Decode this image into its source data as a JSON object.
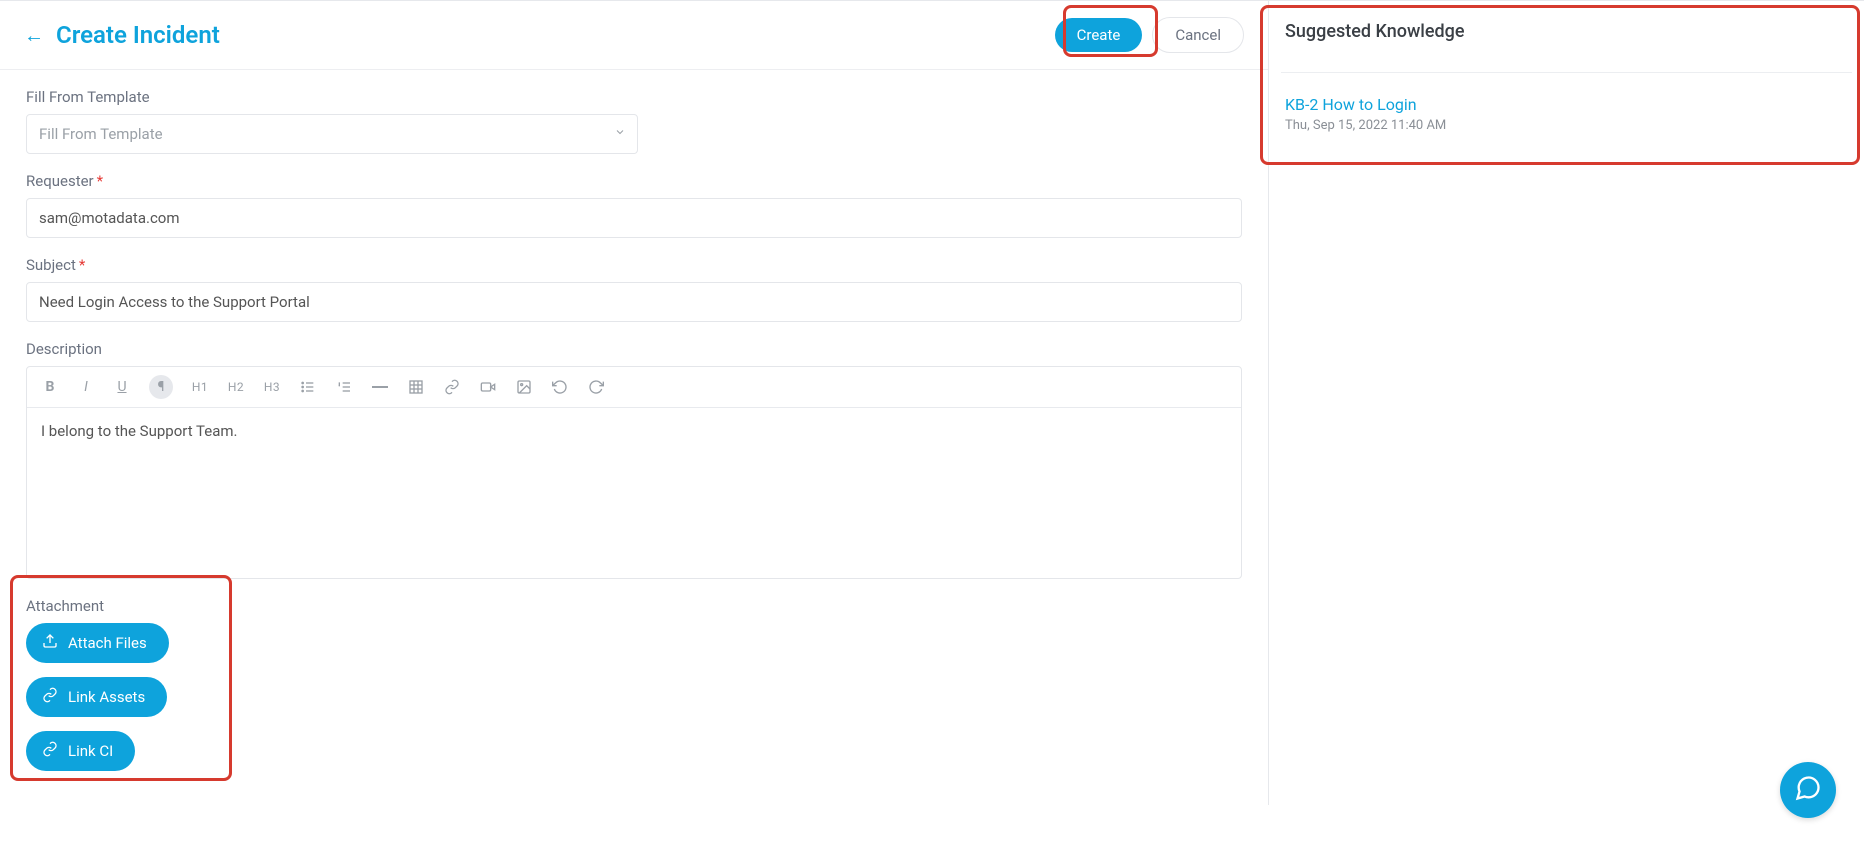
{
  "header": {
    "title": "Create Incident",
    "create_label": "Create",
    "cancel_label": "Cancel"
  },
  "form": {
    "template_label": "Fill From Template",
    "template_placeholder": "Fill From Template",
    "requester_label": "Requester",
    "requester_value": "sam@motadata.com",
    "subject_label": "Subject",
    "subject_value": "Need Login Access to the Support Portal",
    "description_label": "Description",
    "description_value": "I belong to the Support Team."
  },
  "toolbar": {
    "bold": "B",
    "italic": "I",
    "underline": "U",
    "paragraph": "¶",
    "h1": "H1",
    "h2": "H2",
    "h3": "H3"
  },
  "attachment": {
    "section_label": "Attachment",
    "attach_files": "Attach Files",
    "link_assets": "Link Assets",
    "link_ci": "Link CI"
  },
  "suggested": {
    "title": "Suggested Knowledge",
    "item_title": "KB-2 How to Login",
    "item_date": "Thu, Sep 15, 2022 11:40 AM"
  }
}
